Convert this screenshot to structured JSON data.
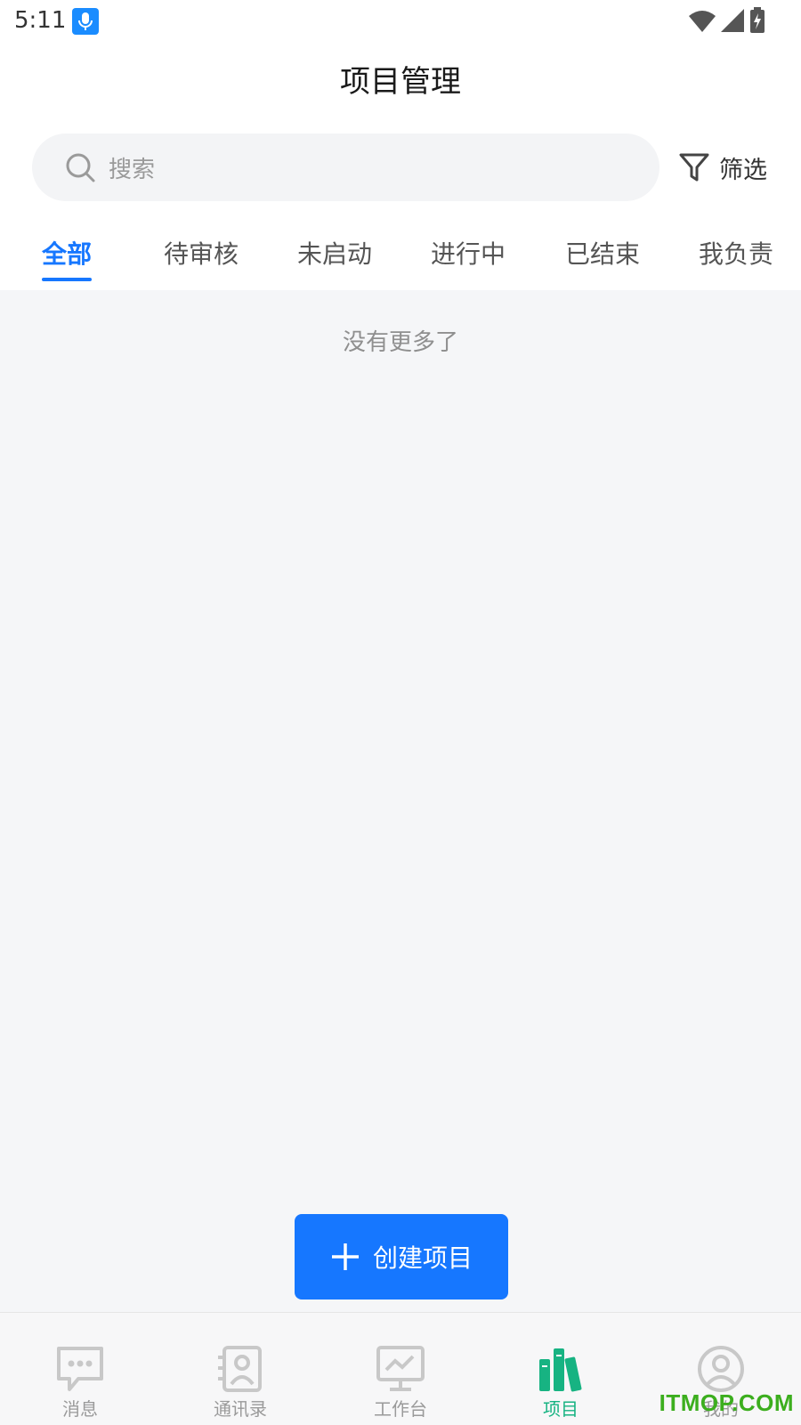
{
  "status_bar": {
    "time": "5:11"
  },
  "header": {
    "title": "项目管理"
  },
  "search": {
    "placeholder": "搜索"
  },
  "filter": {
    "label": "筛选"
  },
  "tabs": [
    {
      "label": "全部",
      "active": true
    },
    {
      "label": "待审核"
    },
    {
      "label": "未启动"
    },
    {
      "label": "进行中"
    },
    {
      "label": "已结束"
    },
    {
      "label": "我负责"
    }
  ],
  "content": {
    "empty_text": "没有更多了"
  },
  "create_button": {
    "label": "创建项目"
  },
  "bottom_nav": [
    {
      "label": "消息",
      "icon": "message-icon"
    },
    {
      "label": "通讯录",
      "icon": "contacts-icon"
    },
    {
      "label": "工作台",
      "icon": "workbench-icon"
    },
    {
      "label": "项目",
      "icon": "project-icon",
      "active": true
    },
    {
      "label": "我的",
      "icon": "profile-icon"
    }
  ],
  "watermark": "ITMOP.COM",
  "colors": {
    "accent": "#1677ff",
    "nav_active": "#17b382",
    "content_bg": "#f5f6f8"
  }
}
